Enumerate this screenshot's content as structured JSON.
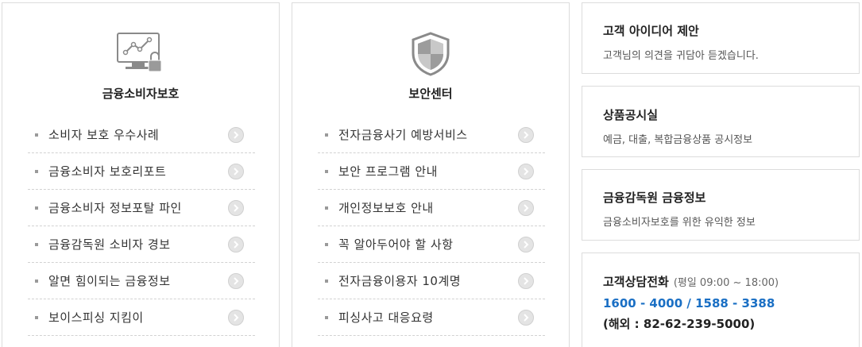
{
  "consumer_protection": {
    "title": "금융소비자보호",
    "icon": "monitor-lock-icon",
    "items": [
      {
        "label": "소비자 보호 우수사례"
      },
      {
        "label": "금융소비자 보호리포트"
      },
      {
        "label": "금융소비자 정보포탈 파인"
      },
      {
        "label": "금융감독원 소비자 경보"
      },
      {
        "label": "알면 힘이되는 금융정보"
      },
      {
        "label": "보이스피싱 지킴이"
      }
    ]
  },
  "security_center": {
    "title": "보안센터",
    "icon": "shield-icon",
    "items": [
      {
        "label": "전자금융사기 예방서비스"
      },
      {
        "label": "보안 프로그램 안내"
      },
      {
        "label": "개인정보보호 안내"
      },
      {
        "label": "꼭 알아두어야 할 사항"
      },
      {
        "label": "전자금융이용자 10계명"
      },
      {
        "label": "피싱사고 대응요령"
      }
    ]
  },
  "cards": {
    "idea": {
      "title": "고객 아이디어 제안",
      "desc": "고객님의 의견을 귀담아 듣겠습니다."
    },
    "product": {
      "title": "상품공시실",
      "desc": "예금, 대출, 복합금융상품 공시정보"
    },
    "fss": {
      "title": "금융감독원 금융정보",
      "desc": "금융소비자보호를 위한 유익한 정보"
    },
    "phone": {
      "title": "고객상담전화",
      "hours": "(평일 09:00 ~ 18:00)",
      "numbers": "1600 - 4000 / 1588 - 3388",
      "overseas": "(해외 : 82-62-239-5000)"
    }
  },
  "colors": {
    "accent_blue": "#1a6fc4",
    "border": "#dcdcdc",
    "icon_gray": "#8a8a8a"
  }
}
